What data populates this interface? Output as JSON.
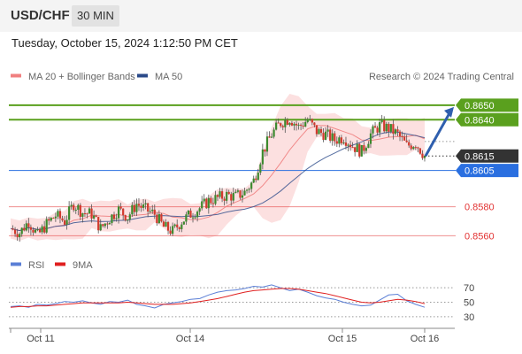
{
  "header": {
    "symbol": "USD/CHF",
    "timeframe": "30 MIN"
  },
  "datetime": "Tuesday, October 15, 2024 1:12:50 PM CET",
  "legend": {
    "items": [
      {
        "label": "MA 20 + Bollinger Bands",
        "color": "#f08080"
      },
      {
        "label": "MA 50",
        "color": "#2b4a8a"
      }
    ],
    "credit": "Research © 2024 Trading Central"
  },
  "rsi_legend": {
    "items": [
      {
        "label": "RSI",
        "color": "#5b7fd6"
      },
      {
        "label": "9MA",
        "color": "#e02020"
      }
    ]
  },
  "chart_data": [
    {
      "type": "candlestick",
      "ylim": [
        0.8548,
        0.8664
      ],
      "x_tick_labels": [
        "Oct 11",
        "Oct 14",
        "Oct 15",
        "Oct 16"
      ],
      "last_price": "0.8615",
      "forecast": {
        "from": 0.8615,
        "to": 0.865
      },
      "levels": [
        {
          "value": 0.865,
          "label": "0.8650",
          "kind": "resistance",
          "color": "#5aa01e"
        },
        {
          "value": 0.864,
          "label": "0.8640",
          "kind": "resistance",
          "color": "#5aa01e"
        },
        {
          "value": 0.8605,
          "label": "0.8605",
          "kind": "pivot",
          "color": "#2a6fe0"
        },
        {
          "value": 0.858,
          "label": "0.8580",
          "kind": "support",
          "color": "#e23333"
        },
        {
          "value": 0.856,
          "label": "0.8560",
          "kind": "support",
          "color": "#e23333"
        }
      ],
      "close_path": [
        0.8565,
        0.8562,
        0.857,
        0.856,
        0.8568,
        0.8574,
        0.857,
        0.8582,
        0.8576,
        0.8575,
        0.8565,
        0.8572,
        0.8578,
        0.8573,
        0.8582,
        0.8578,
        0.8575,
        0.8566,
        0.8563,
        0.857,
        0.8575,
        0.8579,
        0.8584,
        0.8586,
        0.8588,
        0.8587,
        0.859,
        0.8598,
        0.8618,
        0.863,
        0.8638,
        0.8641,
        0.8635,
        0.864,
        0.8632,
        0.863,
        0.8626,
        0.8628,
        0.8622,
        0.8618,
        0.863,
        0.8636,
        0.8634,
        0.863,
        0.8622,
        0.8624,
        0.8615
      ]
    },
    {
      "type": "line",
      "name_label": "RSI",
      "ylim": [
        20,
        80
      ],
      "yticks": [
        70,
        50,
        30
      ],
      "rsi": [
        44,
        45,
        43,
        47,
        46,
        48,
        51,
        50,
        52,
        49,
        47,
        51,
        50,
        53,
        47,
        45,
        42,
        47,
        49,
        51,
        54,
        55,
        60,
        64,
        66,
        67,
        69,
        72,
        71,
        74,
        70,
        66,
        68,
        64,
        59,
        56,
        54,
        50,
        47,
        45,
        46,
        53,
        60,
        61,
        52,
        47,
        43
      ],
      "rsi_ma": [
        43,
        44,
        44,
        45,
        45,
        46,
        47,
        48,
        49,
        49,
        49,
        49,
        49,
        50,
        49,
        48,
        47,
        47,
        47,
        48,
        49,
        51,
        53,
        55,
        58,
        61,
        64,
        66,
        67,
        68,
        69,
        69,
        68,
        66,
        64,
        62,
        59,
        56,
        53,
        50,
        49,
        50,
        52,
        54,
        53,
        51,
        48
      ]
    }
  ]
}
